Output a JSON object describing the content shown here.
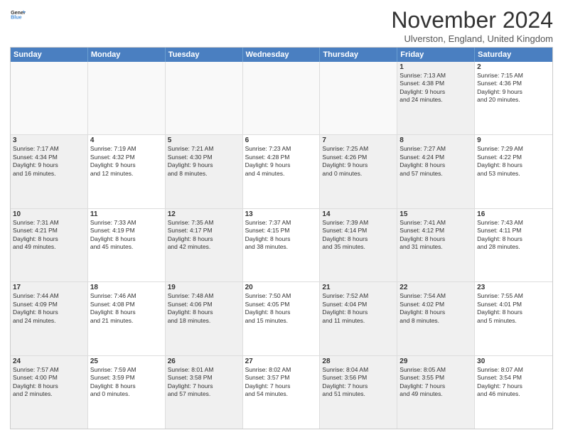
{
  "header": {
    "logo_line1": "General",
    "logo_line2": "Blue",
    "month_title": "November 2024",
    "location": "Ulverston, England, United Kingdom"
  },
  "weekdays": [
    "Sunday",
    "Monday",
    "Tuesday",
    "Wednesday",
    "Thursday",
    "Friday",
    "Saturday"
  ],
  "rows": [
    [
      {
        "day": "",
        "lines": [],
        "empty": true
      },
      {
        "day": "",
        "lines": [],
        "empty": true
      },
      {
        "day": "",
        "lines": [],
        "empty": true
      },
      {
        "day": "",
        "lines": [],
        "empty": true
      },
      {
        "day": "",
        "lines": [],
        "empty": true
      },
      {
        "day": "1",
        "lines": [
          "Sunrise: 7:13 AM",
          "Sunset: 4:38 PM",
          "Daylight: 9 hours",
          "and 24 minutes."
        ],
        "shaded": true
      },
      {
        "day": "2",
        "lines": [
          "Sunrise: 7:15 AM",
          "Sunset: 4:36 PM",
          "Daylight: 9 hours",
          "and 20 minutes."
        ],
        "shaded": false
      }
    ],
    [
      {
        "day": "3",
        "lines": [
          "Sunrise: 7:17 AM",
          "Sunset: 4:34 PM",
          "Daylight: 9 hours",
          "and 16 minutes."
        ],
        "shaded": true
      },
      {
        "day": "4",
        "lines": [
          "Sunrise: 7:19 AM",
          "Sunset: 4:32 PM",
          "Daylight: 9 hours",
          "and 12 minutes."
        ],
        "shaded": false
      },
      {
        "day": "5",
        "lines": [
          "Sunrise: 7:21 AM",
          "Sunset: 4:30 PM",
          "Daylight: 9 hours",
          "and 8 minutes."
        ],
        "shaded": true
      },
      {
        "day": "6",
        "lines": [
          "Sunrise: 7:23 AM",
          "Sunset: 4:28 PM",
          "Daylight: 9 hours",
          "and 4 minutes."
        ],
        "shaded": false
      },
      {
        "day": "7",
        "lines": [
          "Sunrise: 7:25 AM",
          "Sunset: 4:26 PM",
          "Daylight: 9 hours",
          "and 0 minutes."
        ],
        "shaded": true
      },
      {
        "day": "8",
        "lines": [
          "Sunrise: 7:27 AM",
          "Sunset: 4:24 PM",
          "Daylight: 8 hours",
          "and 57 minutes."
        ],
        "shaded": true
      },
      {
        "day": "9",
        "lines": [
          "Sunrise: 7:29 AM",
          "Sunset: 4:22 PM",
          "Daylight: 8 hours",
          "and 53 minutes."
        ],
        "shaded": false
      }
    ],
    [
      {
        "day": "10",
        "lines": [
          "Sunrise: 7:31 AM",
          "Sunset: 4:21 PM",
          "Daylight: 8 hours",
          "and 49 minutes."
        ],
        "shaded": true
      },
      {
        "day": "11",
        "lines": [
          "Sunrise: 7:33 AM",
          "Sunset: 4:19 PM",
          "Daylight: 8 hours",
          "and 45 minutes."
        ],
        "shaded": false
      },
      {
        "day": "12",
        "lines": [
          "Sunrise: 7:35 AM",
          "Sunset: 4:17 PM",
          "Daylight: 8 hours",
          "and 42 minutes."
        ],
        "shaded": true
      },
      {
        "day": "13",
        "lines": [
          "Sunrise: 7:37 AM",
          "Sunset: 4:15 PM",
          "Daylight: 8 hours",
          "and 38 minutes."
        ],
        "shaded": false
      },
      {
        "day": "14",
        "lines": [
          "Sunrise: 7:39 AM",
          "Sunset: 4:14 PM",
          "Daylight: 8 hours",
          "and 35 minutes."
        ],
        "shaded": true
      },
      {
        "day": "15",
        "lines": [
          "Sunrise: 7:41 AM",
          "Sunset: 4:12 PM",
          "Daylight: 8 hours",
          "and 31 minutes."
        ],
        "shaded": true
      },
      {
        "day": "16",
        "lines": [
          "Sunrise: 7:43 AM",
          "Sunset: 4:11 PM",
          "Daylight: 8 hours",
          "and 28 minutes."
        ],
        "shaded": false
      }
    ],
    [
      {
        "day": "17",
        "lines": [
          "Sunrise: 7:44 AM",
          "Sunset: 4:09 PM",
          "Daylight: 8 hours",
          "and 24 minutes."
        ],
        "shaded": true
      },
      {
        "day": "18",
        "lines": [
          "Sunrise: 7:46 AM",
          "Sunset: 4:08 PM",
          "Daylight: 8 hours",
          "and 21 minutes."
        ],
        "shaded": false
      },
      {
        "day": "19",
        "lines": [
          "Sunrise: 7:48 AM",
          "Sunset: 4:06 PM",
          "Daylight: 8 hours",
          "and 18 minutes."
        ],
        "shaded": true
      },
      {
        "day": "20",
        "lines": [
          "Sunrise: 7:50 AM",
          "Sunset: 4:05 PM",
          "Daylight: 8 hours",
          "and 15 minutes."
        ],
        "shaded": false
      },
      {
        "day": "21",
        "lines": [
          "Sunrise: 7:52 AM",
          "Sunset: 4:04 PM",
          "Daylight: 8 hours",
          "and 11 minutes."
        ],
        "shaded": true
      },
      {
        "day": "22",
        "lines": [
          "Sunrise: 7:54 AM",
          "Sunset: 4:02 PM",
          "Daylight: 8 hours",
          "and 8 minutes."
        ],
        "shaded": true
      },
      {
        "day": "23",
        "lines": [
          "Sunrise: 7:55 AM",
          "Sunset: 4:01 PM",
          "Daylight: 8 hours",
          "and 5 minutes."
        ],
        "shaded": false
      }
    ],
    [
      {
        "day": "24",
        "lines": [
          "Sunrise: 7:57 AM",
          "Sunset: 4:00 PM",
          "Daylight: 8 hours",
          "and 2 minutes."
        ],
        "shaded": true
      },
      {
        "day": "25",
        "lines": [
          "Sunrise: 7:59 AM",
          "Sunset: 3:59 PM",
          "Daylight: 8 hours",
          "and 0 minutes."
        ],
        "shaded": false
      },
      {
        "day": "26",
        "lines": [
          "Sunrise: 8:01 AM",
          "Sunset: 3:58 PM",
          "Daylight: 7 hours",
          "and 57 minutes."
        ],
        "shaded": true
      },
      {
        "day": "27",
        "lines": [
          "Sunrise: 8:02 AM",
          "Sunset: 3:57 PM",
          "Daylight: 7 hours",
          "and 54 minutes."
        ],
        "shaded": false
      },
      {
        "day": "28",
        "lines": [
          "Sunrise: 8:04 AM",
          "Sunset: 3:56 PM",
          "Daylight: 7 hours",
          "and 51 minutes."
        ],
        "shaded": true
      },
      {
        "day": "29",
        "lines": [
          "Sunrise: 8:05 AM",
          "Sunset: 3:55 PM",
          "Daylight: 7 hours",
          "and 49 minutes."
        ],
        "shaded": true
      },
      {
        "day": "30",
        "lines": [
          "Sunrise: 8:07 AM",
          "Sunset: 3:54 PM",
          "Daylight: 7 hours",
          "and 46 minutes."
        ],
        "shaded": false
      }
    ]
  ]
}
